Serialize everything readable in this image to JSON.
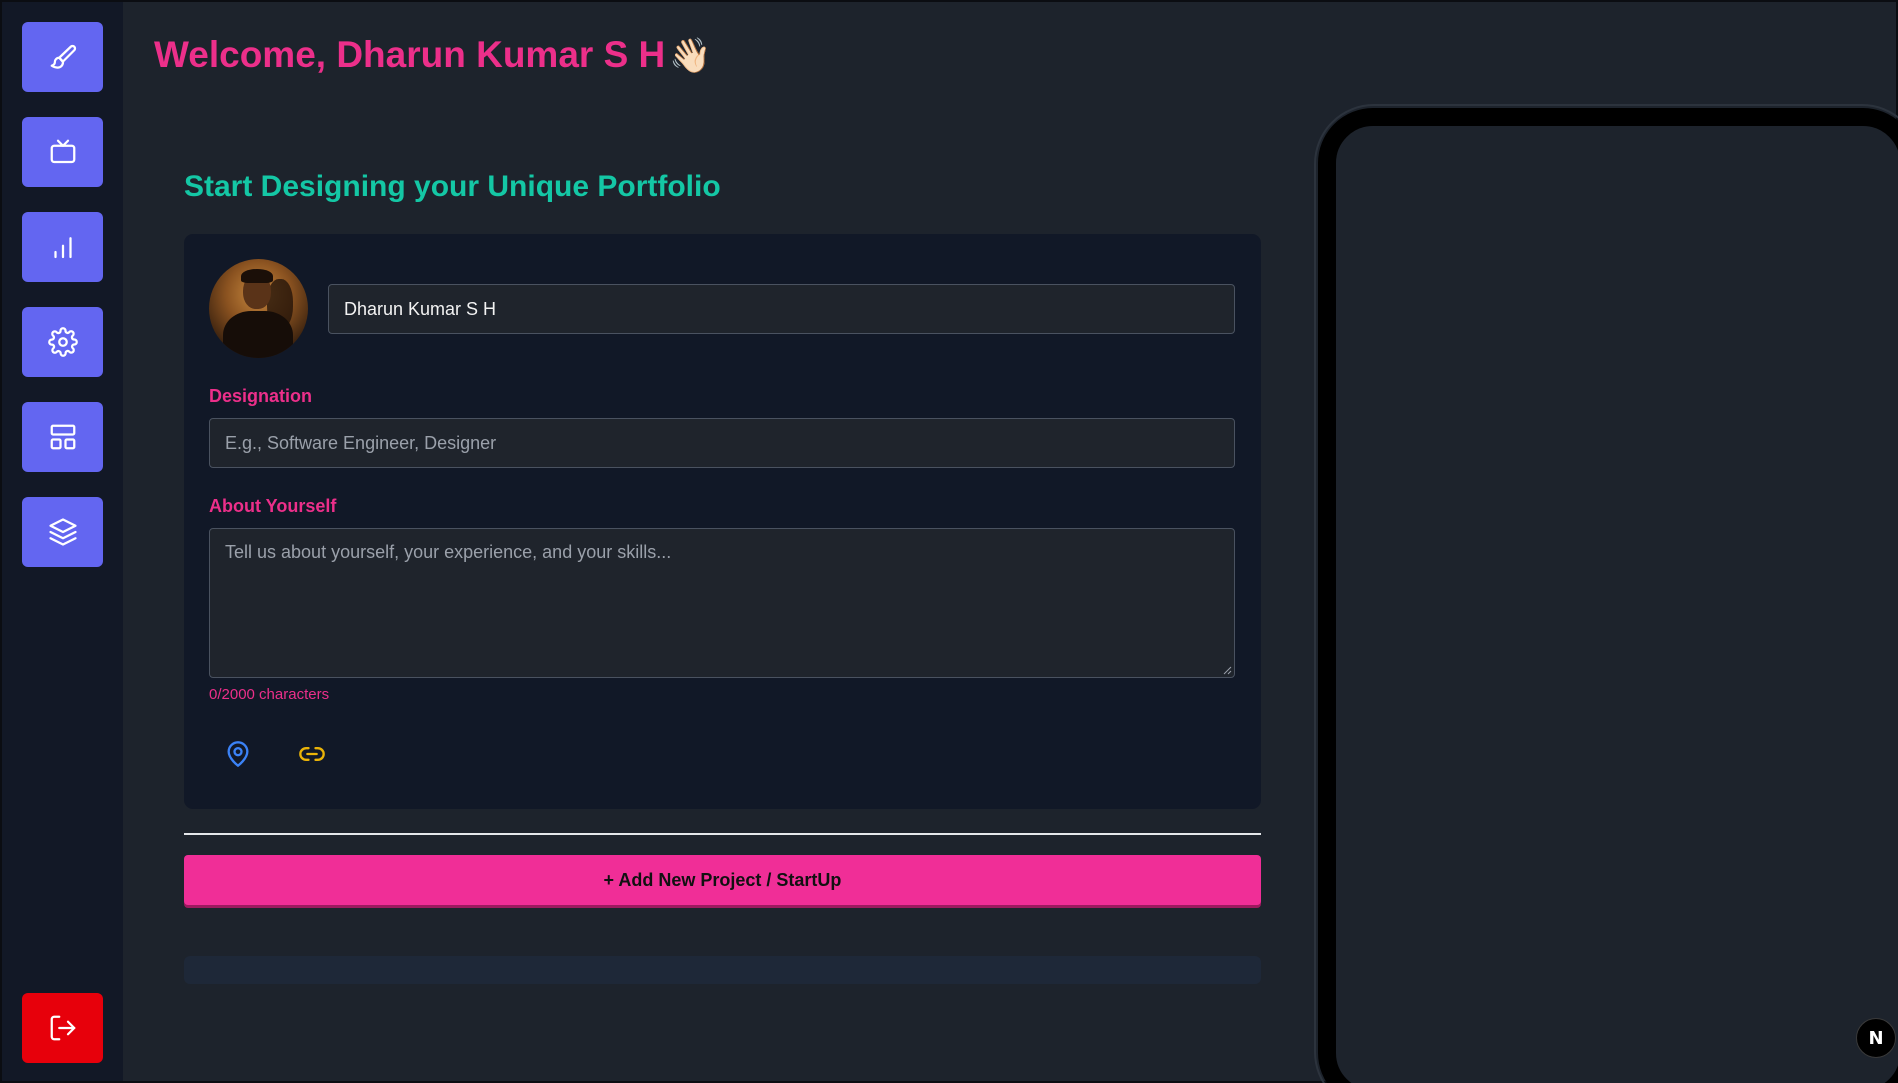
{
  "sidebar": {
    "items": [
      {
        "icon": "brush-icon"
      },
      {
        "icon": "tv-icon"
      },
      {
        "icon": "bar-chart-icon"
      },
      {
        "icon": "gear-icon"
      },
      {
        "icon": "layout-icon"
      },
      {
        "icon": "layers-icon"
      }
    ],
    "logout_icon": "logout-icon",
    "accent": "#6366f1",
    "logout_color": "#e7000b"
  },
  "header": {
    "welcome": "Welcome, Dharun Kumar S H",
    "wave": "👋🏻"
  },
  "main": {
    "title": "Start Designing your Unique Portfolio",
    "name_value": "Dharun Kumar S H",
    "designation_label": "Designation",
    "designation_placeholder": "E.g., Software Engineer, Designer",
    "about_label": "About Yourself",
    "about_placeholder": "Tell us about yourself, your experience, and your skills...",
    "char_counter": "0/2000 characters",
    "location_icon": "map-pin-icon",
    "link_icon": "link-icon",
    "add_project_label": "+ Add New Project / StartUp"
  },
  "preview": {
    "badge": "N"
  },
  "colors": {
    "pink": "#ec2f8a",
    "teal": "#14c7a5",
    "button_pink": "#f02e97"
  }
}
